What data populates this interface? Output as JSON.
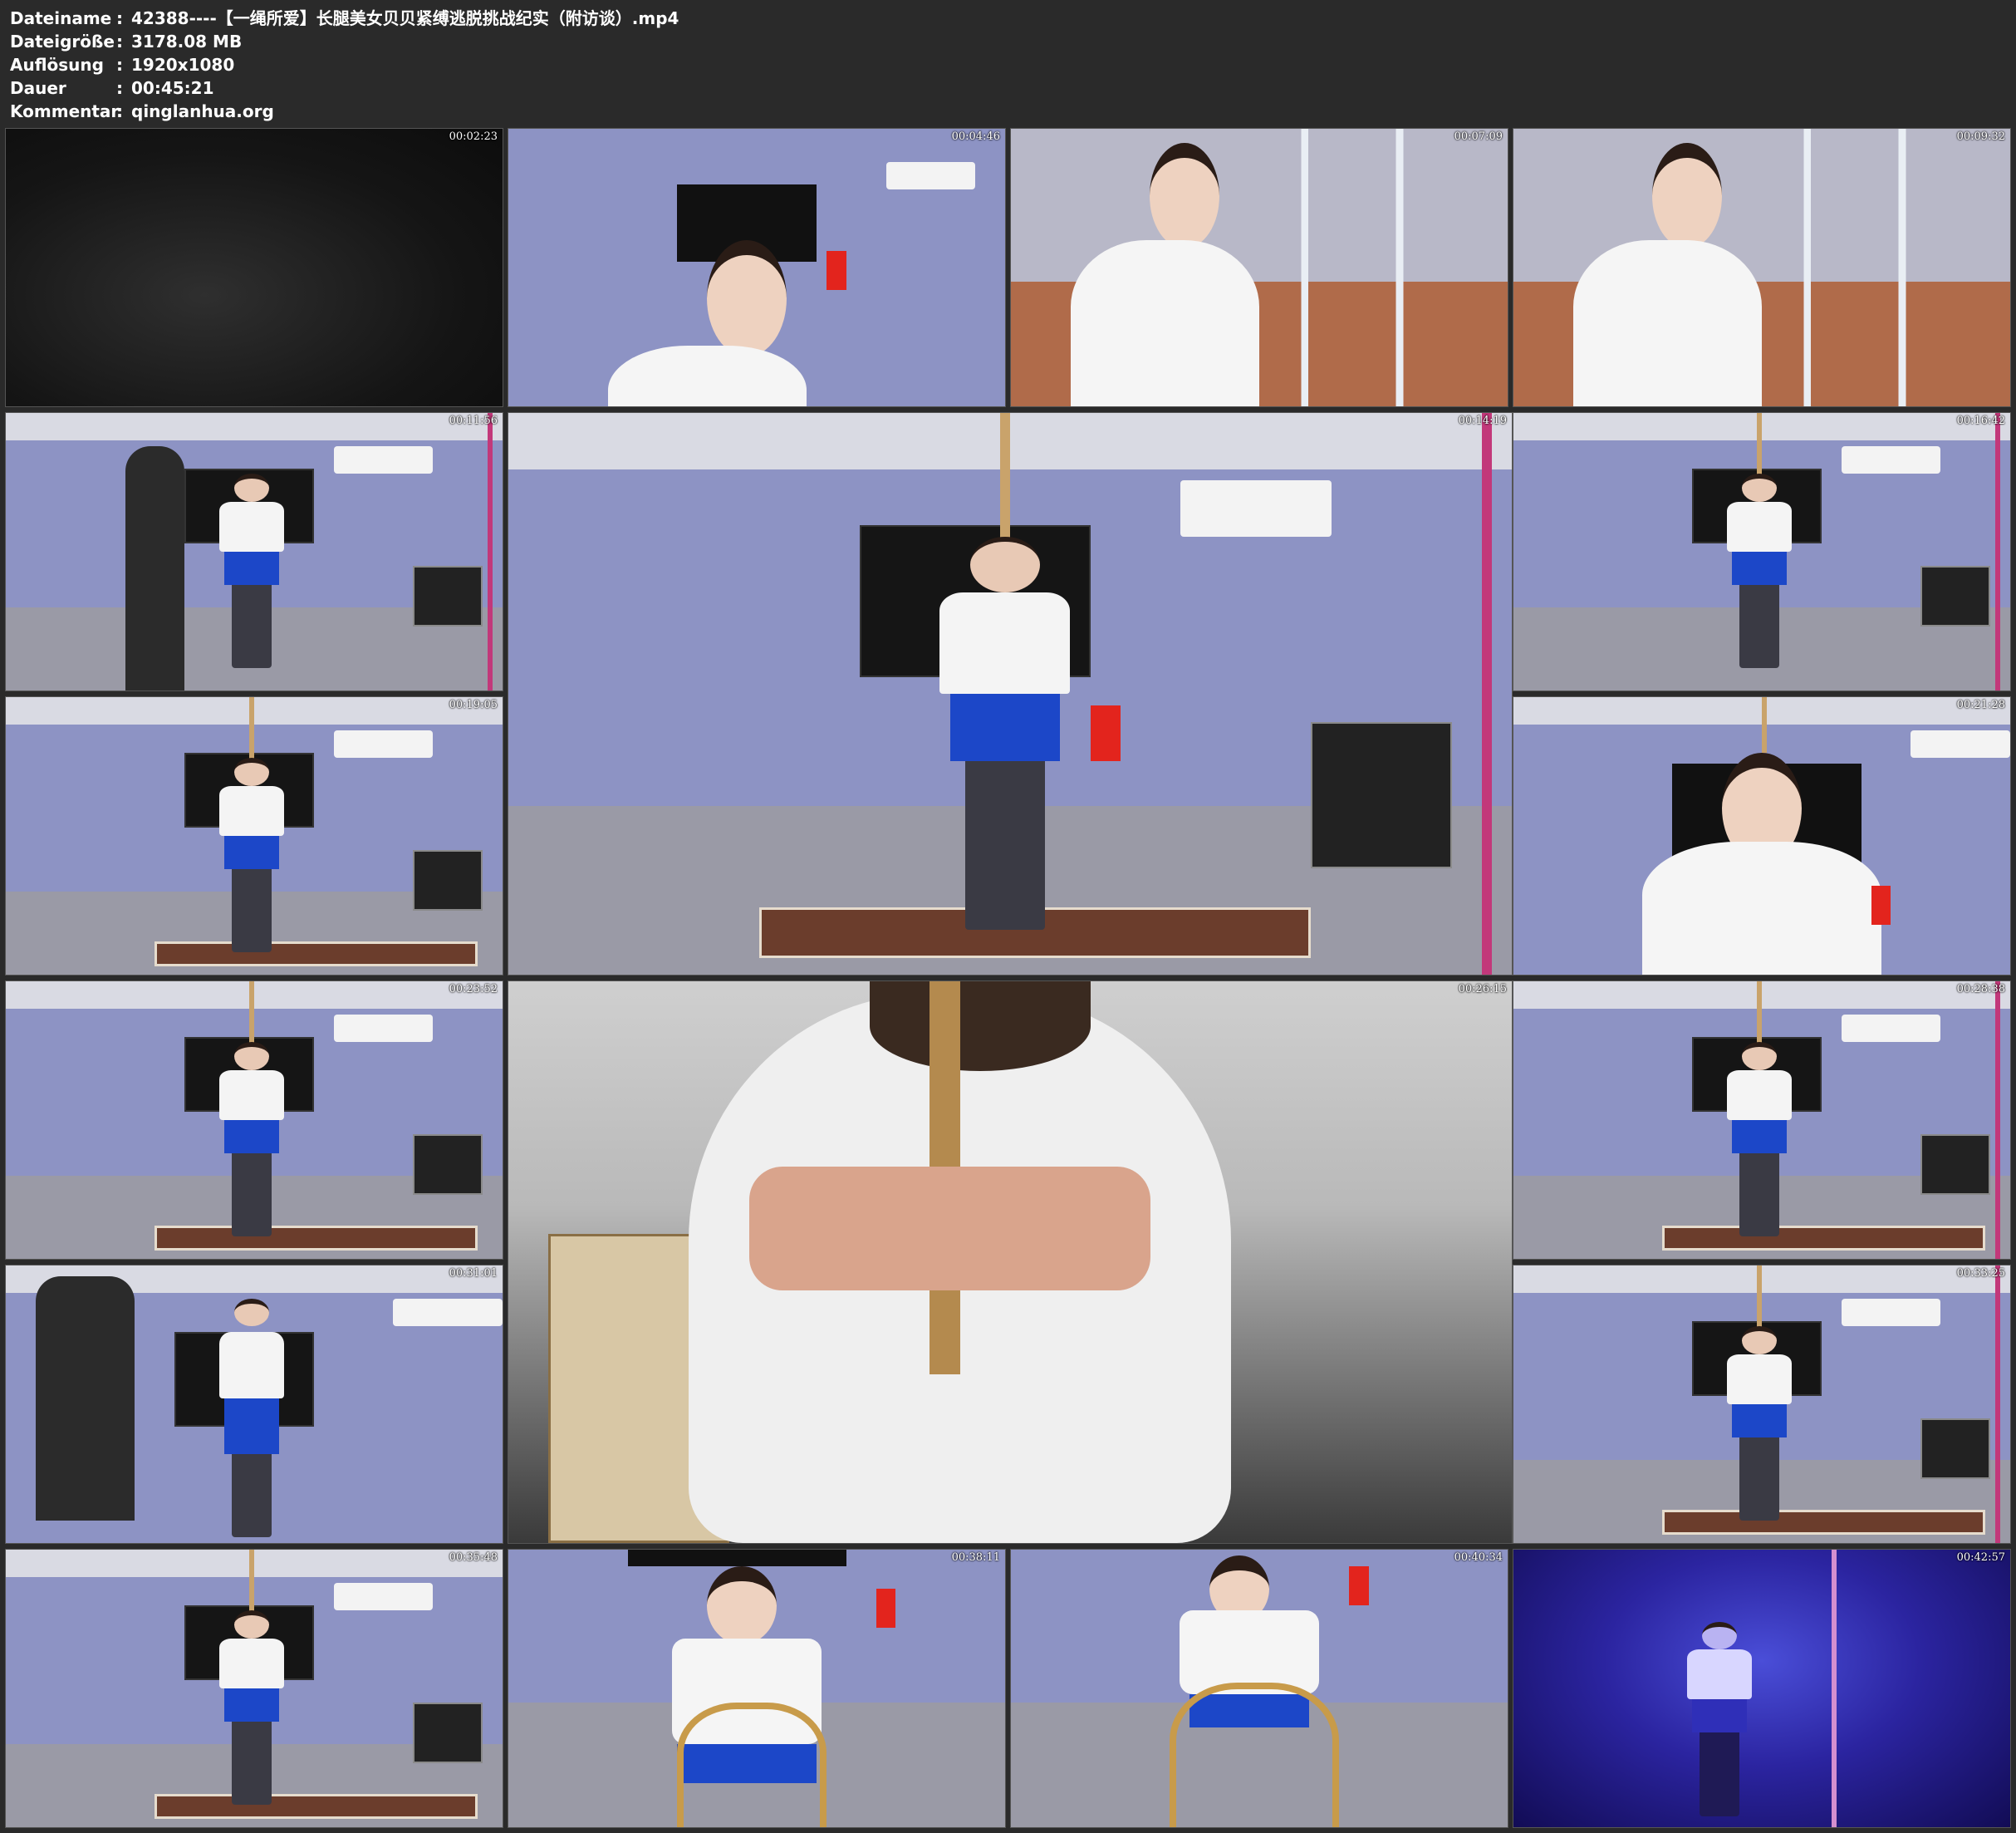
{
  "info": {
    "rows": [
      {
        "label": "Dateiname",
        "sep": ":",
        "value": "42388----【一绳所爱】长腿美女贝贝紧缚逃脱挑战纪实（附访谈）.mp4"
      },
      {
        "label": "Dateigröße",
        "sep": ":",
        "value": "3178.08 MB"
      },
      {
        "label": "Auflösung",
        "sep": ":",
        "value": "1920x1080"
      },
      {
        "label": "Dauer",
        "sep": ":",
        "value": "00:45:21"
      },
      {
        "label": "Kommentar",
        "sep": ":",
        "value": "qinglanhua.org"
      }
    ]
  },
  "thumbnails": [
    {
      "timestamp": "00:02:23"
    },
    {
      "timestamp": "00:04:46"
    },
    {
      "timestamp": "00:07:09"
    },
    {
      "timestamp": "00:09:32"
    },
    {
      "timestamp": "00:11:56"
    },
    {
      "timestamp": "00:14:19"
    },
    {
      "timestamp": "00:16:42"
    },
    {
      "timestamp": "00:19:05"
    },
    {
      "timestamp": "00:21:28"
    },
    {
      "timestamp": "00:23:52"
    },
    {
      "timestamp": "00:26:15"
    },
    {
      "timestamp": "00:28:38"
    },
    {
      "timestamp": "00:31:01"
    },
    {
      "timestamp": "00:33:25"
    },
    {
      "timestamp": "00:35:48"
    },
    {
      "timestamp": "00:38:11"
    },
    {
      "timestamp": "00:40:34"
    },
    {
      "timestamp": "00:42:57"
    }
  ],
  "colors": {
    "background": "#2a2a2a",
    "text": "#ffffff",
    "wall": "#8d93c4",
    "skirt": "#1c47c8",
    "uv_light": "#2b24a0"
  }
}
